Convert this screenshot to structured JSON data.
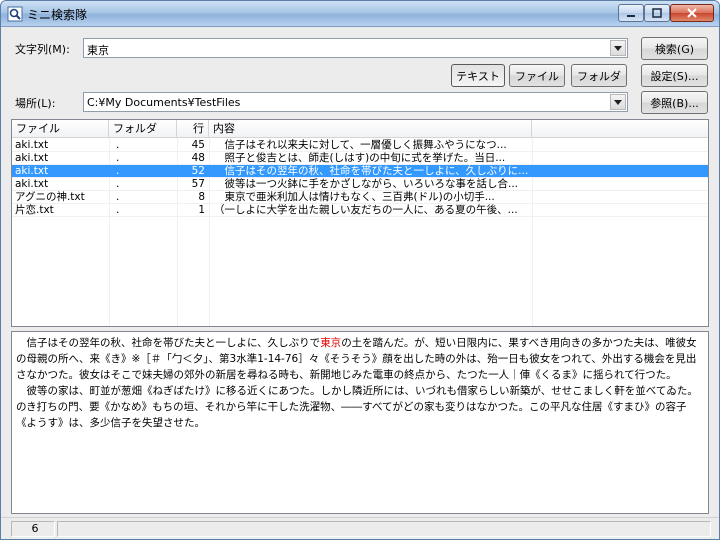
{
  "window": {
    "title": "ミニ検索隊"
  },
  "form": {
    "text_label": "文字列(M):",
    "text_value": "東京",
    "place_label": "場所(L):",
    "place_value": "C:¥My Documents¥TestFiles"
  },
  "buttons": {
    "search": "検索(G)",
    "settings": "設定(S)...",
    "browse": "参照(B)...",
    "text_mode": "テキスト",
    "file_mode": "ファイル",
    "folder_mode": "フォルダ"
  },
  "results": {
    "columns": [
      "ファイル",
      "フォルダ",
      "行",
      "内容"
    ],
    "rows": [
      {
        "file": "aki.txt",
        "folder": ".",
        "line": "45",
        "content": "　信子はそれ以来夫に対して、一層優しく振舞ふやうになつ..."
      },
      {
        "file": "aki.txt",
        "folder": ".",
        "line": "48",
        "content": "　照子と俊吉とは、師走(しはす)の中旬に式を挙げた。当日..."
      },
      {
        "file": "aki.txt",
        "folder": ".",
        "line": "52",
        "content": "　信子はその翌年の秋、社命を帯びた夫と一しよに、久しぶりに..."
      },
      {
        "file": "aki.txt",
        "folder": ".",
        "line": "57",
        "content": "　彼等は一つ火鉢に手をかざしながら、いろいろな事を話し合..."
      },
      {
        "file": "アグニの神.txt",
        "folder": ".",
        "line": "8",
        "content": "　東京で亜米利加人は情けもなく、三百弗(ドル)の小切手..."
      },
      {
        "file": "片恋.txt",
        "folder": ".",
        "line": "1",
        "content": "（一しよに大学を出た親しい友だちの一人に、ある夏の午後、..."
      }
    ],
    "selected_index": 2
  },
  "preview": {
    "p1_before": "　信子はその翌年の秋、社命を帯びた夫と一しよに、久しぶりで",
    "p1_highlight": "東京",
    "p1_after": "の土を踏んだ。が、短い日限内に、果すべき用向きの多かつた夫は、唯彼女の母親の所へ、来《き》※［＃「勹＜夕」、第3水準1-14-76］々《そうそう》顔を出した時の外は、殆一日も彼女をつれて、外出する機会を見出さなかつた。彼女はそこで妹夫婦の郊外の新居を尋ねる時も、新開地じみた電車の終点から、たつた一人｜俥《くるま》に揺られて行つた。",
    "p2": "　彼等の家は、町並が葱畑《ねぎばたけ》に移る近くにあつた。しかし隣近所には、いづれも借家らしい新築が、せせこましく軒を並べてゐた。のき打ちの門、要《かなめ》もちの垣、それから竿に干した洗濯物、――すべてがどの家も変りはなかつた。この平凡な住居《すまひ》の容子《ようす》は、多少信子を失望させた。"
  },
  "status": {
    "count": "6"
  },
  "colors": {
    "selection": "#3399ff",
    "highlight": "#e00000"
  }
}
